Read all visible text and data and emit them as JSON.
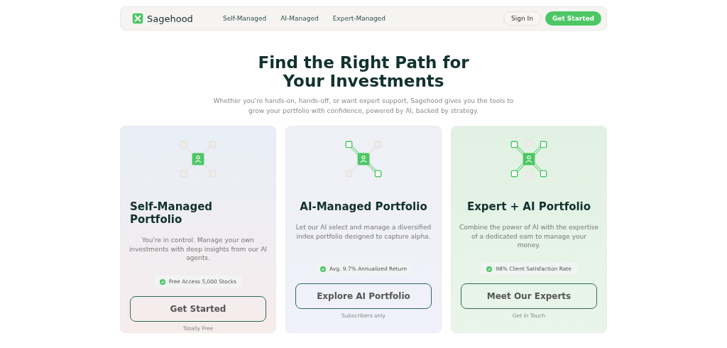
{
  "nav": {
    "brand": "Sagehood",
    "links": [
      "Self-Managed",
      "AI-Managed",
      "Expert-Managed"
    ],
    "sign_in": "Sign In",
    "get_started": "Get Started"
  },
  "hero": {
    "title_lines": [
      "Find the Right Path for",
      "Your Investments"
    ],
    "subtitle": "Whether you're hands-on, hands-off, or want expert support, Sagehood gives you the tools to grow your portfolio with confidence, powered by AI, backed by strategy."
  },
  "cards": [
    {
      "kind": "self",
      "title": "Self-Managed Portfolio",
      "description": "You're in control. Manage your own investments with deep insights from our AI agents.",
      "badge": "Free Access 5,000 Stocks",
      "button": "Get Started",
      "note": "Totally Free"
    },
    {
      "kind": "ai",
      "title": "AI-Managed Portfolio",
      "description": "Let our AI select and manage a diversified index portfolio designed to capture alpha.",
      "badge": "Avg. 9.7% Annualized Return",
      "button": "Explore AI Portfolio",
      "note": "Subscribers only"
    },
    {
      "kind": "expert",
      "title": "Expert + AI Portfolio",
      "description": "Combine the power of AI with the expertise of a dedicated eam to manage your money.",
      "badge": "98% Client Satisfaction Rate",
      "button": "Meet Our Experts",
      "note": "Get in Touch"
    }
  ]
}
